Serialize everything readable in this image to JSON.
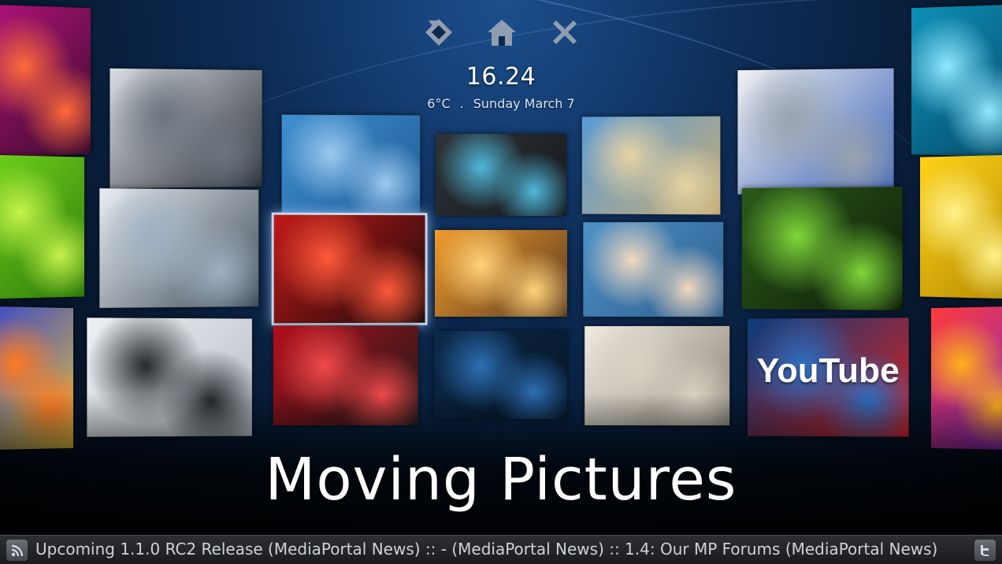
{
  "top_controls": [
    {
      "name": "back-icon"
    },
    {
      "name": "home-icon"
    },
    {
      "name": "close-icon"
    }
  ],
  "clock": {
    "time": "16.24"
  },
  "weather": {
    "temperature": "6°C",
    "separator": ".",
    "date": "Sunday March 7"
  },
  "section": {
    "title": "Moving Pictures"
  },
  "ticker": {
    "text": "Upcoming 1.1.0 RC2 Release (MediaPortal News) :: - (MediaPortal News) :: 1.4: Our MP Forums (MediaPortal News)",
    "left_icon": "rss-icon",
    "right_icon": "twitter-icon"
  },
  "tiles": [
    {
      "name": "tile-bokeh-pink",
      "label": "",
      "colors": [
        "#b0127a",
        "#ff6a3a",
        "#3b0c2c"
      ]
    },
    {
      "name": "tile-camera-lenses",
      "label": "",
      "colors": [
        "#d8dde2",
        "#6c7480",
        "#2a2f36"
      ]
    },
    {
      "name": "tile-sky-clouds",
      "label": "",
      "colors": [
        "#3f8fd0",
        "#9cc9ef",
        "#1f5d97"
      ]
    },
    {
      "name": "tile-media-keys",
      "label": "",
      "colors": [
        "#2e3338",
        "#4fb7d9",
        "#15181c"
      ]
    },
    {
      "name": "tile-beach-bottle",
      "label": "",
      "colors": [
        "#5a9ad6",
        "#e6d3a3",
        "#c8ad74"
      ]
    },
    {
      "name": "tile-laptop-mouse",
      "label": "",
      "colors": [
        "#f2f2f2",
        "#9aa3ad",
        "#3a62b8"
      ]
    },
    {
      "name": "tile-bokeh-cyan",
      "label": "",
      "colors": [
        "#0e8fb8",
        "#8fe8ff",
        "#054b6a"
      ]
    },
    {
      "name": "tile-green-drops",
      "label": "",
      "colors": [
        "#6fd21b",
        "#c6f24a",
        "#2f7a0b"
      ]
    },
    {
      "name": "tile-camcorder",
      "label": "",
      "colors": [
        "#e9eef3",
        "#9fb0c2",
        "#3d4a57"
      ]
    },
    {
      "name": "tile-cinema-seats",
      "label": "",
      "colors": [
        "#c01818",
        "#ff5a3a",
        "#1b0b0b"
      ]
    },
    {
      "name": "tile-flat-tv",
      "label": "",
      "colors": [
        "#f19a2a",
        "#ffd27a",
        "#5a3c22"
      ]
    },
    {
      "name": "tile-newspaper-man",
      "label": "",
      "colors": [
        "#4d91c8",
        "#f0d9c0",
        "#2e5f8e"
      ]
    },
    {
      "name": "tile-film-reel",
      "label": "",
      "colors": [
        "#2b5a1a",
        "#7fd63a",
        "#0d1d08"
      ]
    },
    {
      "name": "tile-yellow-light",
      "label": "",
      "colors": [
        "#ffd21a",
        "#fff28a",
        "#b58a00"
      ]
    },
    {
      "name": "tile-orange-swirl",
      "label": "",
      "colors": [
        "#3b48c8",
        "#ff7b22",
        "#e8c33a"
      ]
    },
    {
      "name": "tile-hifi-radio",
      "label": "",
      "colors": [
        "#eef1f4",
        "#25282c",
        "#b7bfc7"
      ]
    },
    {
      "name": "tile-lastfm",
      "label": "",
      "colors": [
        "#b30d1a",
        "#f04a4a",
        "#1c1c1c"
      ]
    },
    {
      "name": "tile-headphones",
      "label": "",
      "colors": [
        "#0c2a4a",
        "#2d6fb3",
        "#061425"
      ]
    },
    {
      "name": "tile-retro-radio",
      "label": "",
      "colors": [
        "#f1ece2",
        "#d8d2c4",
        "#8a8478"
      ]
    },
    {
      "name": "tile-youtube",
      "label": "YouTube",
      "colors": [
        "#0a3b7a",
        "#2b6fc2",
        "#d42020"
      ]
    },
    {
      "name": "tile-rainbow-swirl",
      "label": "",
      "colors": [
        "#ff3b3b",
        "#ffb11a",
        "#7b27c8"
      ]
    }
  ]
}
